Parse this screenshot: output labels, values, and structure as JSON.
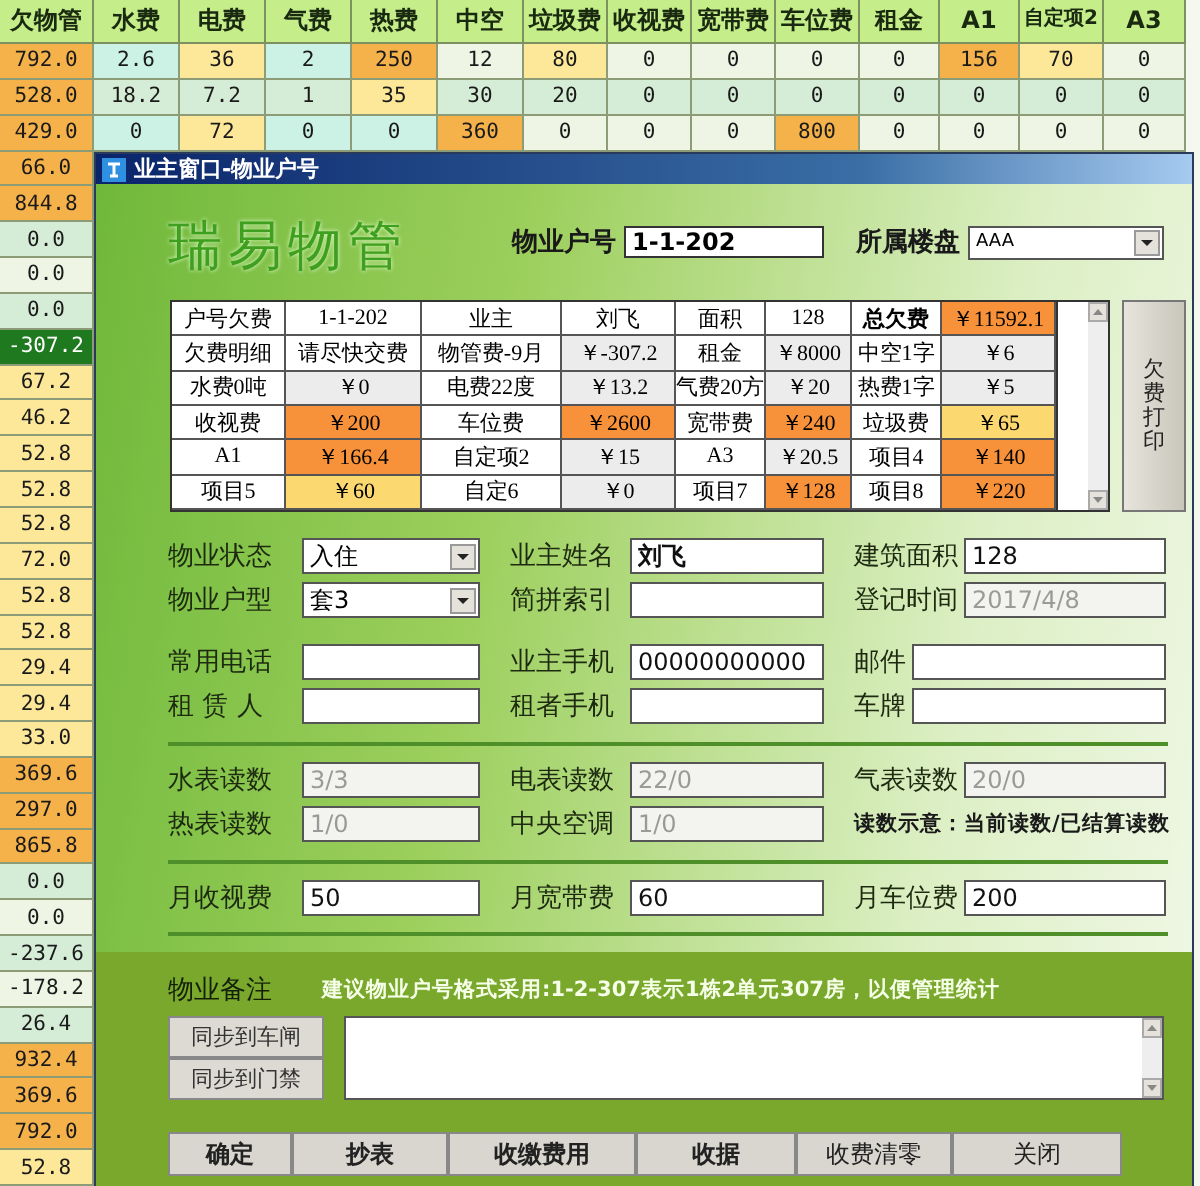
{
  "sheet": {
    "columns": [
      "欠物管",
      "水费",
      "电费",
      "气费",
      "热费",
      "中空",
      "垃圾费",
      "收视费",
      "宽带费",
      "车位费",
      "租金",
      "A1",
      "自定项2",
      "A3"
    ],
    "rows": [
      {
        "cells": [
          {
            "text": "792.0",
            "color": "#f6b24a"
          },
          {
            "text": "2.6",
            "color": "#ccf2e6"
          },
          {
            "text": "36",
            "color": "#fde89a"
          },
          {
            "text": "2",
            "color": "#ccf2e6"
          },
          {
            "text": "250",
            "color": "#f6b24a"
          },
          {
            "text": "12",
            "color": "#eef5e4"
          },
          {
            "text": "80",
            "color": "#fde89a"
          },
          {
            "text": "0",
            "color": "#eef5e4"
          },
          {
            "text": "0",
            "color": "#eef5e4"
          },
          {
            "text": "0",
            "color": "#eef5e4"
          },
          {
            "text": "0",
            "color": "#eef5e4"
          },
          {
            "text": "156",
            "color": "#f6b24a"
          },
          {
            "text": "70",
            "color": "#fde89a"
          },
          {
            "text": "0",
            "color": "#eef5e4"
          }
        ]
      },
      {
        "cells": [
          {
            "text": "528.0",
            "color": "#f6b24a"
          },
          {
            "text": "18.2",
            "color": "#d5ecd6"
          },
          {
            "text": "7.2",
            "color": "#d5ecd6"
          },
          {
            "text": "1",
            "color": "#d5ecd6"
          },
          {
            "text": "35",
            "color": "#fde89a"
          },
          {
            "text": "30",
            "color": "#d5ecd6"
          },
          {
            "text": "20",
            "color": "#d5ecd6"
          },
          {
            "text": "0",
            "color": "#d5ecd6"
          },
          {
            "text": "0",
            "color": "#d5ecd6"
          },
          {
            "text": "0",
            "color": "#d5ecd6"
          },
          {
            "text": "0",
            "color": "#d5ecd6"
          },
          {
            "text": "0",
            "color": "#d5ecd6"
          },
          {
            "text": "0",
            "color": "#d5ecd6"
          },
          {
            "text": "0",
            "color": "#d5ecd6"
          }
        ]
      },
      {
        "cells": [
          {
            "text": "429.0",
            "color": "#f6b24a"
          },
          {
            "text": "0",
            "color": "#ccf2e6"
          },
          {
            "text": "72",
            "color": "#fde89a"
          },
          {
            "text": "0",
            "color": "#ccf2e6"
          },
          {
            "text": "0",
            "color": "#ccf2e6"
          },
          {
            "text": "360",
            "color": "#f6b24a"
          },
          {
            "text": "0",
            "color": "#eef5e4"
          },
          {
            "text": "0",
            "color": "#eef5e4"
          },
          {
            "text": "0",
            "color": "#eef5e4"
          },
          {
            "text": "800",
            "color": "#f6b24a"
          },
          {
            "text": "0",
            "color": "#eef5e4"
          },
          {
            "text": "0",
            "color": "#eef5e4"
          },
          {
            "text": "0",
            "color": "#eef5e4"
          },
          {
            "text": "0",
            "color": "#eef5e4"
          }
        ]
      },
      {
        "cells": [
          {
            "text": "66.0",
            "color": "#f6b24a"
          }
        ]
      },
      {
        "cells": [
          {
            "text": "844.8",
            "color": "#f6b24a"
          }
        ]
      },
      {
        "cells": [
          {
            "text": "0.0",
            "color": "#d5ecd6"
          }
        ]
      },
      {
        "cells": [
          {
            "text": "0.0",
            "color": "#eef5e4"
          }
        ]
      },
      {
        "cells": [
          {
            "text": "0.0",
            "color": "#d5ecd6"
          }
        ]
      },
      {
        "cells": [
          {
            "text": "-307.2",
            "color": "#1f7a1f"
          }
        ]
      },
      {
        "cells": [
          {
            "text": "67.2",
            "color": "#fde89a"
          }
        ]
      },
      {
        "cells": [
          {
            "text": "46.2",
            "color": "#fde89a"
          }
        ]
      },
      {
        "cells": [
          {
            "text": "52.8",
            "color": "#fde89a"
          }
        ]
      },
      {
        "cells": [
          {
            "text": "52.8",
            "color": "#fde89a"
          }
        ]
      },
      {
        "cells": [
          {
            "text": "52.8",
            "color": "#fde89a"
          }
        ]
      },
      {
        "cells": [
          {
            "text": "72.0",
            "color": "#fde89a"
          }
        ]
      },
      {
        "cells": [
          {
            "text": "52.8",
            "color": "#fde89a"
          }
        ]
      },
      {
        "cells": [
          {
            "text": "52.8",
            "color": "#fde89a"
          }
        ]
      },
      {
        "cells": [
          {
            "text": "29.4",
            "color": "#fde89a"
          }
        ]
      },
      {
        "cells": [
          {
            "text": "29.4",
            "color": "#fde89a"
          }
        ]
      },
      {
        "cells": [
          {
            "text": "33.0",
            "color": "#fde89a"
          }
        ]
      },
      {
        "cells": [
          {
            "text": "369.6",
            "color": "#f6b24a"
          }
        ]
      },
      {
        "cells": [
          {
            "text": "297.0",
            "color": "#f6b24a"
          }
        ]
      },
      {
        "cells": [
          {
            "text": "865.8",
            "color": "#f6b24a"
          }
        ]
      },
      {
        "cells": [
          {
            "text": "0.0",
            "color": "#d5ecd6"
          }
        ]
      },
      {
        "cells": [
          {
            "text": "0.0",
            "color": "#eef5e4"
          }
        ]
      },
      {
        "cells": [
          {
            "text": "-237.6",
            "color": "#d5ecd6"
          }
        ]
      },
      {
        "cells": [
          {
            "text": "-178.2",
            "color": "#eef5e4"
          }
        ]
      },
      {
        "cells": [
          {
            "text": "26.4",
            "color": "#d5ecd6"
          }
        ]
      },
      {
        "cells": [
          {
            "text": "932.4",
            "color": "#f6b24a"
          }
        ]
      },
      {
        "cells": [
          {
            "text": "369.6",
            "color": "#f6b24a"
          }
        ]
      },
      {
        "cells": [
          {
            "text": "792.0",
            "color": "#f6b24a"
          }
        ]
      },
      {
        "cells": [
          {
            "text": "52.8",
            "color": "#fde89a"
          }
        ]
      }
    ]
  },
  "dialog": {
    "title": "业主窗口-物业户号",
    "logo": "瑞易物管",
    "account": {
      "label": "物业户号",
      "value": "1-1-202"
    },
    "estate": {
      "label": "所属楼盘",
      "value": "AAA"
    },
    "summary": {
      "rows": [
        [
          {
            "text": "户号欠费",
            "color": "#ffffff"
          },
          {
            "text": "1-1-202",
            "color": "#ffffff"
          },
          {
            "text": "业主",
            "color": "#ffffff"
          },
          {
            "text": "刘飞",
            "color": "#ffffff"
          },
          {
            "text": "面积",
            "color": "#ffffff"
          },
          {
            "text": "128",
            "color": "#ffffff"
          },
          {
            "text": "总欠费",
            "color": "#ffffff",
            "bold": true
          },
          {
            "text": "￥11592.1",
            "color": "#f7923a"
          }
        ],
        [
          {
            "text": "欠费明细",
            "color": "#ffffff"
          },
          {
            "text": "请尽快交费",
            "color": "#ffffff"
          },
          {
            "text": "物管费-9月",
            "color": "#ffffff"
          },
          {
            "text": "￥-307.2",
            "color": "#ececec"
          },
          {
            "text": "租金",
            "color": "#ffffff"
          },
          {
            "text": "￥8000",
            "color": "#ececec"
          },
          {
            "text": "中空1字",
            "color": "#ffffff"
          },
          {
            "text": "￥6",
            "color": "#ececec"
          }
        ],
        [
          {
            "text": "水费0吨",
            "color": "#ffffff"
          },
          {
            "text": "￥0",
            "color": "#ececec"
          },
          {
            "text": "电费22度",
            "color": "#ffffff"
          },
          {
            "text": "￥13.2",
            "color": "#ececec"
          },
          {
            "text": "气费20方",
            "color": "#ffffff"
          },
          {
            "text": "￥20",
            "color": "#ececec"
          },
          {
            "text": "热费1字",
            "color": "#ffffff"
          },
          {
            "text": "￥5",
            "color": "#ececec"
          }
        ],
        [
          {
            "text": "收视费",
            "color": "#ffffff"
          },
          {
            "text": "￥200",
            "color": "#f7923a"
          },
          {
            "text": "车位费",
            "color": "#ffffff"
          },
          {
            "text": "￥2600",
            "color": "#f7923a"
          },
          {
            "text": "宽带费",
            "color": "#ffffff"
          },
          {
            "text": "￥240",
            "color": "#f7923a"
          },
          {
            "text": "垃圾费",
            "color": "#ffffff"
          },
          {
            "text": "￥65",
            "color": "#fcd870"
          }
        ],
        [
          {
            "text": "A1",
            "color": "#ffffff"
          },
          {
            "text": "￥166.4",
            "color": "#f7923a"
          },
          {
            "text": "自定项2",
            "color": "#ffffff"
          },
          {
            "text": "￥15",
            "color": "#ececec"
          },
          {
            "text": "A3",
            "color": "#ffffff"
          },
          {
            "text": "￥20.5",
            "color": "#ececec"
          },
          {
            "text": "项目4",
            "color": "#ffffff"
          },
          {
            "text": "￥140",
            "color": "#f7923a"
          }
        ],
        [
          {
            "text": "项目5",
            "color": "#ffffff"
          },
          {
            "text": "￥60",
            "color": "#fcd870"
          },
          {
            "text": "自定6",
            "color": "#ffffff"
          },
          {
            "text": "￥0",
            "color": "#ececec"
          },
          {
            "text": "项目7",
            "color": "#ffffff"
          },
          {
            "text": "￥128",
            "color": "#f7923a"
          },
          {
            "text": "项目8",
            "color": "#ffffff"
          },
          {
            "text": "￥220",
            "color": "#f7923a"
          }
        ]
      ]
    },
    "print_button": "欠费打印",
    "sections": [
      {
        "rows": [
          [
            {
              "kind": "select",
              "label": "物业状态",
              "value": "入住",
              "disabled": false
            },
            {
              "kind": "input",
              "label": "业主姓名",
              "value": "刘飞",
              "disabled": false,
              "bold": true
            },
            {
              "kind": "input",
              "label": "建筑面积",
              "value": "128",
              "disabled": false
            }
          ],
          [
            {
              "kind": "select",
              "label": "物业户型",
              "value": "套3",
              "disabled": false
            },
            {
              "kind": "input",
              "label": "简拼索引",
              "disabled": false
            },
            {
              "kind": "input",
              "label": "登记时间",
              "value": "2017/4/8",
              "disabled": true
            }
          ]
        ]
      },
      {
        "rows": [
          [
            {
              "kind": "input",
              "label": "常用电话",
              "disabled": false
            },
            {
              "kind": "input",
              "label": "业主手机",
              "value": "00000000000",
              "disabled": false
            },
            {
              "kind": "input",
              "label": "邮件",
              "disabled": false
            }
          ],
          [
            {
              "kind": "input",
              "label": "租 赁 人",
              "disabled": false
            },
            {
              "kind": "input",
              "label": "租者手机",
              "disabled": false
            },
            {
              "kind": "input",
              "label": "车牌",
              "disabled": false
            }
          ]
        ]
      },
      {
        "ruled": true,
        "rows": [
          [
            {
              "kind": "input",
              "label": "水表读数",
              "value": "3/3",
              "disabled": true
            },
            {
              "kind": "input",
              "label": "电表读数",
              "value": "22/0",
              "disabled": true
            },
            {
              "kind": "input",
              "label": "气表读数",
              "value": "20/0",
              "disabled": true
            }
          ],
          [
            {
              "kind": "input",
              "label": "热表读数",
              "value": "1/0",
              "disabled": true
            },
            {
              "kind": "input",
              "label": "中央空调",
              "value": "1/0",
              "disabled": true
            },
            {
              "kind": "note",
              "text": "读数示意：当前读数/已结算读数"
            }
          ]
        ]
      },
      {
        "ruled": true,
        "rows": [
          [
            {
              "kind": "input",
              "label": "月收视费",
              "value": "50",
              "disabled": false
            },
            {
              "kind": "input",
              "label": "月宽带费",
              "value": "60",
              "disabled": false
            },
            {
              "kind": "input",
              "label": "月车位费",
              "value": "200",
              "disabled": false
            }
          ]
        ]
      }
    ],
    "remarks": {
      "label": "物业备注",
      "hint": "建议物业户号格式采用:1-2-307表示1栋2单元307房，以便管理统计",
      "sync_buttons": [
        "同步到车闸",
        "同步到门禁"
      ]
    },
    "buttons": [
      {
        "label": "确定",
        "bold": true
      },
      {
        "label": "抄表",
        "bold": true
      },
      {
        "label": "收缴费用",
        "bold": true
      },
      {
        "label": "收据",
        "bold": true
      },
      {
        "label": "收费清零",
        "bold": false
      },
      {
        "label": "关闭",
        "bold": false
      }
    ]
  }
}
